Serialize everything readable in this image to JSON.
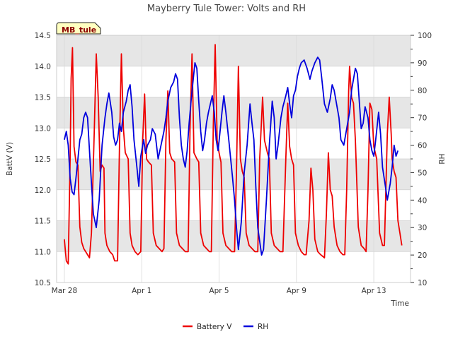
{
  "chart_data": {
    "type": "line",
    "title": "Mayberry Tule Tower: Volts and RH",
    "station_label": "MB_tule",
    "xlabel": "Time",
    "ylabel_left": "BattV (V)",
    "ylabel_right": "RH",
    "xlim": [
      -0.4,
      17.9
    ],
    "x_ticks": [
      {
        "value": 0,
        "label": "Mar 28"
      },
      {
        "value": 4,
        "label": "Apr 1"
      },
      {
        "value": 8,
        "label": "Apr 5"
      },
      {
        "value": 12,
        "label": "Apr 9"
      },
      {
        "value": 16,
        "label": "Apr 13"
      }
    ],
    "y_left": {
      "lim": [
        10.5,
        14.5
      ],
      "ticks": [
        10.5,
        11.0,
        11.5,
        12.0,
        12.5,
        13.0,
        13.5,
        14.0,
        14.5
      ]
    },
    "y_right": {
      "lim": [
        10,
        100
      ],
      "ticks": [
        10,
        20,
        30,
        40,
        50,
        60,
        70,
        80,
        90,
        100
      ]
    },
    "grid": true,
    "shaded_bands": true,
    "legend_position": "bottom-center",
    "series": [
      {
        "name": "Battery V",
        "axis": "left",
        "color": "#ee0000",
        "points": [
          [
            0.0,
            11.2
          ],
          [
            0.1,
            10.85
          ],
          [
            0.2,
            10.8
          ],
          [
            0.3,
            12.5
          ],
          [
            0.35,
            13.8
          ],
          [
            0.42,
            14.3
          ],
          [
            0.5,
            12.7
          ],
          [
            0.6,
            12.45
          ],
          [
            0.7,
            12.4
          ],
          [
            0.8,
            11.4
          ],
          [
            0.9,
            11.15
          ],
          [
            1.0,
            11.05
          ],
          [
            1.1,
            11.0
          ],
          [
            1.2,
            10.95
          ],
          [
            1.3,
            10.9
          ],
          [
            1.4,
            11.3
          ],
          [
            1.55,
            13.0
          ],
          [
            1.65,
            14.2
          ],
          [
            1.75,
            13.5
          ],
          [
            1.85,
            12.3
          ],
          [
            1.95,
            12.4
          ],
          [
            2.05,
            12.35
          ],
          [
            2.1,
            11.3
          ],
          [
            2.2,
            11.1
          ],
          [
            2.35,
            11.0
          ],
          [
            2.5,
            10.95
          ],
          [
            2.6,
            10.85
          ],
          [
            2.75,
            10.85
          ],
          [
            2.85,
            12.7
          ],
          [
            2.95,
            14.2
          ],
          [
            3.05,
            13.0
          ],
          [
            3.15,
            12.6
          ],
          [
            3.3,
            12.5
          ],
          [
            3.4,
            11.3
          ],
          [
            3.5,
            11.1
          ],
          [
            3.65,
            11.0
          ],
          [
            3.8,
            10.95
          ],
          [
            3.95,
            11.0
          ],
          [
            4.05,
            12.8
          ],
          [
            4.15,
            13.55
          ],
          [
            4.25,
            12.5
          ],
          [
            4.35,
            12.45
          ],
          [
            4.5,
            12.4
          ],
          [
            4.6,
            11.3
          ],
          [
            4.75,
            11.1
          ],
          [
            4.9,
            11.05
          ],
          [
            5.05,
            11.0
          ],
          [
            5.15,
            11.05
          ],
          [
            5.25,
            12.8
          ],
          [
            5.35,
            13.6
          ],
          [
            5.45,
            12.6
          ],
          [
            5.55,
            12.5
          ],
          [
            5.7,
            12.45
          ],
          [
            5.8,
            11.3
          ],
          [
            5.95,
            11.1
          ],
          [
            6.1,
            11.05
          ],
          [
            6.25,
            11.0
          ],
          [
            6.4,
            11.0
          ],
          [
            6.5,
            13.0
          ],
          [
            6.6,
            14.2
          ],
          [
            6.7,
            12.6
          ],
          [
            6.85,
            12.5
          ],
          [
            6.95,
            12.45
          ],
          [
            7.05,
            11.3
          ],
          [
            7.2,
            11.1
          ],
          [
            7.35,
            11.05
          ],
          [
            7.5,
            11.0
          ],
          [
            7.6,
            11.0
          ],
          [
            7.7,
            13.0
          ],
          [
            7.8,
            14.35
          ],
          [
            7.9,
            12.8
          ],
          [
            8.0,
            12.6
          ],
          [
            8.1,
            12.45
          ],
          [
            8.2,
            11.3
          ],
          [
            8.35,
            11.1
          ],
          [
            8.5,
            11.05
          ],
          [
            8.65,
            11.0
          ],
          [
            8.8,
            11.0
          ],
          [
            8.9,
            12.3
          ],
          [
            9.0,
            14.0
          ],
          [
            9.1,
            12.5
          ],
          [
            9.2,
            12.3
          ],
          [
            9.3,
            12.2
          ],
          [
            9.4,
            11.3
          ],
          [
            9.55,
            11.1
          ],
          [
            9.7,
            11.05
          ],
          [
            9.85,
            11.0
          ],
          [
            10.0,
            11.0
          ],
          [
            10.1,
            12.5
          ],
          [
            10.25,
            13.5
          ],
          [
            10.35,
            12.8
          ],
          [
            10.5,
            12.6
          ],
          [
            10.6,
            12.5
          ],
          [
            10.7,
            11.3
          ],
          [
            10.85,
            11.1
          ],
          [
            11.0,
            11.05
          ],
          [
            11.15,
            11.0
          ],
          [
            11.3,
            11.0
          ],
          [
            11.45,
            12.5
          ],
          [
            11.55,
            13.4
          ],
          [
            11.65,
            12.7
          ],
          [
            11.75,
            12.5
          ],
          [
            11.85,
            12.4
          ],
          [
            11.95,
            11.3
          ],
          [
            12.1,
            11.1
          ],
          [
            12.25,
            11.0
          ],
          [
            12.4,
            10.95
          ],
          [
            12.5,
            10.95
          ],
          [
            12.65,
            11.5
          ],
          [
            12.75,
            12.35
          ],
          [
            12.85,
            12.0
          ],
          [
            12.95,
            11.2
          ],
          [
            13.1,
            11.0
          ],
          [
            13.25,
            10.95
          ],
          [
            13.45,
            10.9
          ],
          [
            13.55,
            11.6
          ],
          [
            13.65,
            12.6
          ],
          [
            13.75,
            12.0
          ],
          [
            13.85,
            11.9
          ],
          [
            13.95,
            11.4
          ],
          [
            14.1,
            11.1
          ],
          [
            14.25,
            11.0
          ],
          [
            14.4,
            10.95
          ],
          [
            14.5,
            10.95
          ],
          [
            14.6,
            12.0
          ],
          [
            14.7,
            13.6
          ],
          [
            14.75,
            14.0
          ],
          [
            14.85,
            13.5
          ],
          [
            14.95,
            13.4
          ],
          [
            15.05,
            12.8
          ],
          [
            15.2,
            11.4
          ],
          [
            15.35,
            11.1
          ],
          [
            15.5,
            11.05
          ],
          [
            15.6,
            11.0
          ],
          [
            15.7,
            12.0
          ],
          [
            15.8,
            13.4
          ],
          [
            15.9,
            13.3
          ],
          [
            16.0,
            12.7
          ],
          [
            16.15,
            12.5
          ],
          [
            16.3,
            11.3
          ],
          [
            16.45,
            11.1
          ],
          [
            16.55,
            11.1
          ],
          [
            16.7,
            12.9
          ],
          [
            16.8,
            13.5
          ],
          [
            16.9,
            12.9
          ],
          [
            16.95,
            12.5
          ],
          [
            17.05,
            12.3
          ],
          [
            17.15,
            12.2
          ],
          [
            17.25,
            11.5
          ],
          [
            17.35,
            11.3
          ],
          [
            17.45,
            11.1
          ]
        ]
      },
      {
        "name": "RH",
        "axis": "right",
        "color": "#0000dd",
        "points": [
          [
            0.0,
            62
          ],
          [
            0.1,
            65
          ],
          [
            0.2,
            60
          ],
          [
            0.3,
            48
          ],
          [
            0.4,
            43
          ],
          [
            0.5,
            42
          ],
          [
            0.6,
            48
          ],
          [
            0.7,
            55
          ],
          [
            0.8,
            62
          ],
          [
            0.9,
            64
          ],
          [
            1.0,
            70
          ],
          [
            1.1,
            72
          ],
          [
            1.2,
            70
          ],
          [
            1.35,
            52
          ],
          [
            1.5,
            35
          ],
          [
            1.65,
            30
          ],
          [
            1.8,
            40
          ],
          [
            1.95,
            60
          ],
          [
            2.1,
            70
          ],
          [
            2.2,
            75
          ],
          [
            2.3,
            79
          ],
          [
            2.45,
            72
          ],
          [
            2.55,
            63
          ],
          [
            2.65,
            60
          ],
          [
            2.75,
            62
          ],
          [
            2.85,
            68
          ],
          [
            2.95,
            65
          ],
          [
            3.05,
            72
          ],
          [
            3.2,
            76
          ],
          [
            3.3,
            80
          ],
          [
            3.4,
            82
          ],
          [
            3.5,
            74
          ],
          [
            3.6,
            62
          ],
          [
            3.75,
            52
          ],
          [
            3.85,
            45
          ],
          [
            3.95,
            56
          ],
          [
            4.1,
            62
          ],
          [
            4.2,
            57
          ],
          [
            4.3,
            60
          ],
          [
            4.45,
            62
          ],
          [
            4.55,
            66
          ],
          [
            4.7,
            64
          ],
          [
            4.85,
            55
          ],
          [
            5.0,
            60
          ],
          [
            5.15,
            65
          ],
          [
            5.25,
            70
          ],
          [
            5.35,
            76
          ],
          [
            5.5,
            81
          ],
          [
            5.65,
            83
          ],
          [
            5.75,
            86
          ],
          [
            5.85,
            84
          ],
          [
            5.95,
            70
          ],
          [
            6.05,
            60
          ],
          [
            6.15,
            55
          ],
          [
            6.25,
            52
          ],
          [
            6.35,
            58
          ],
          [
            6.45,
            68
          ],
          [
            6.55,
            76
          ],
          [
            6.65,
            83
          ],
          [
            6.75,
            90
          ],
          [
            6.85,
            88
          ],
          [
            6.95,
            76
          ],
          [
            7.05,
            65
          ],
          [
            7.15,
            58
          ],
          [
            7.25,
            62
          ],
          [
            7.35,
            68
          ],
          [
            7.45,
            72
          ],
          [
            7.55,
            75
          ],
          [
            7.65,
            78
          ],
          [
            7.75,
            72
          ],
          [
            7.85,
            62
          ],
          [
            7.95,
            58
          ],
          [
            8.05,
            65
          ],
          [
            8.15,
            72
          ],
          [
            8.25,
            78
          ],
          [
            8.35,
            72
          ],
          [
            8.5,
            62
          ],
          [
            8.6,
            55
          ],
          [
            8.7,
            48
          ],
          [
            8.8,
            40
          ],
          [
            8.9,
            30
          ],
          [
            9.0,
            22
          ],
          [
            9.15,
            32
          ],
          [
            9.3,
            50
          ],
          [
            9.45,
            60
          ],
          [
            9.6,
            75
          ],
          [
            9.7,
            68
          ],
          [
            9.8,
            62
          ],
          [
            9.9,
            45
          ],
          [
            10.0,
            30
          ],
          [
            10.1,
            25
          ],
          [
            10.2,
            20
          ],
          [
            10.3,
            22
          ],
          [
            10.45,
            40
          ],
          [
            10.6,
            60
          ],
          [
            10.75,
            76
          ],
          [
            10.85,
            70
          ],
          [
            10.95,
            55
          ],
          [
            11.05,
            60
          ],
          [
            11.2,
            70
          ],
          [
            11.3,
            74
          ],
          [
            11.45,
            78
          ],
          [
            11.55,
            81
          ],
          [
            11.65,
            75
          ],
          [
            11.75,
            70
          ],
          [
            11.85,
            78
          ],
          [
            11.95,
            80
          ],
          [
            12.05,
            85
          ],
          [
            12.15,
            88
          ],
          [
            12.25,
            90
          ],
          [
            12.4,
            91
          ],
          [
            12.55,
            88
          ],
          [
            12.7,
            84
          ],
          [
            12.8,
            87
          ],
          [
            12.95,
            90
          ],
          [
            13.1,
            92
          ],
          [
            13.2,
            91
          ],
          [
            13.3,
            85
          ],
          [
            13.45,
            75
          ],
          [
            13.6,
            72
          ],
          [
            13.75,
            77
          ],
          [
            13.85,
            82
          ],
          [
            13.95,
            80
          ],
          [
            14.05,
            76
          ],
          [
            14.2,
            70
          ],
          [
            14.3,
            62
          ],
          [
            14.45,
            60
          ],
          [
            14.6,
            66
          ],
          [
            14.75,
            72
          ],
          [
            14.85,
            80
          ],
          [
            14.95,
            84
          ],
          [
            15.05,
            88
          ],
          [
            15.15,
            86
          ],
          [
            15.25,
            76
          ],
          [
            15.35,
            66
          ],
          [
            15.45,
            68
          ],
          [
            15.55,
            74
          ],
          [
            15.7,
            70
          ],
          [
            15.8,
            62
          ],
          [
            15.9,
            58
          ],
          [
            16.0,
            56
          ],
          [
            16.1,
            62
          ],
          [
            16.25,
            72
          ],
          [
            16.35,
            64
          ],
          [
            16.45,
            52
          ],
          [
            16.6,
            45
          ],
          [
            16.7,
            40
          ],
          [
            16.85,
            46
          ],
          [
            16.95,
            52
          ],
          [
            17.05,
            60
          ],
          [
            17.15,
            56
          ],
          [
            17.25,
            58
          ]
        ]
      }
    ]
  }
}
